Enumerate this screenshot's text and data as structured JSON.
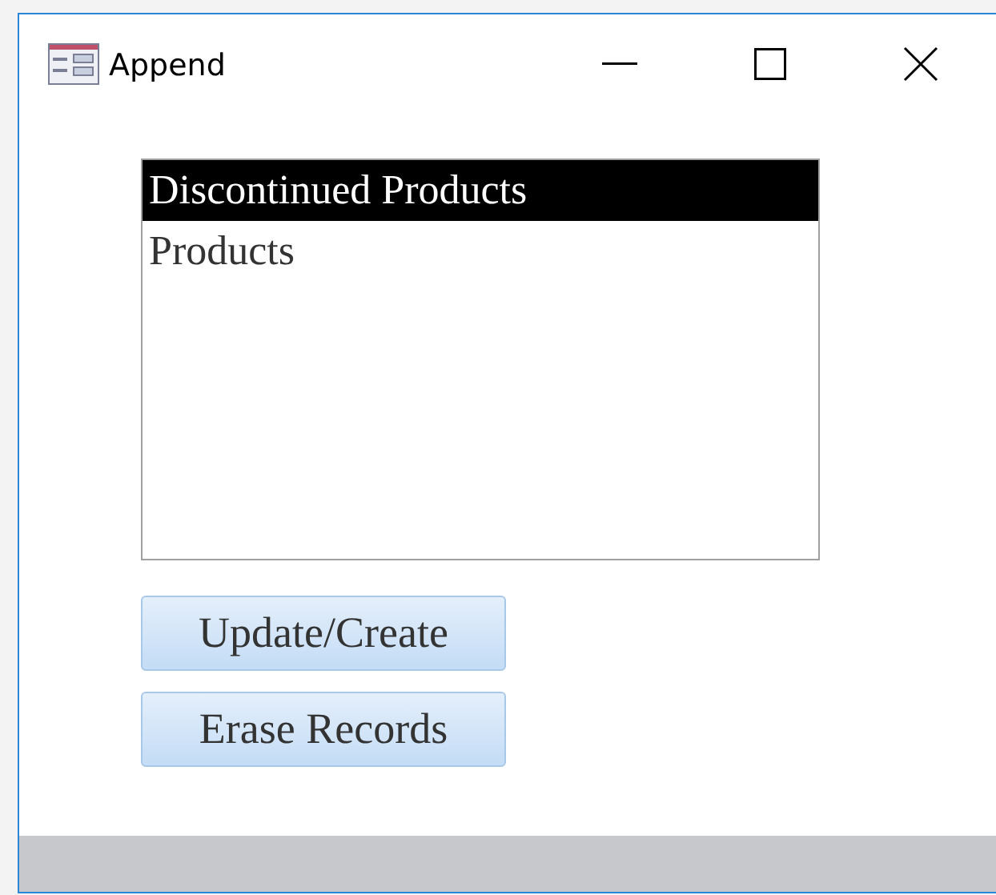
{
  "window": {
    "title": "Append",
    "controls": [
      {
        "kind": "minimize"
      },
      {
        "kind": "maximize"
      },
      {
        "kind": "close"
      }
    ]
  },
  "list": {
    "items": [
      {
        "label": "Discontinued Products",
        "selected": true
      },
      {
        "label": "Products",
        "selected": false
      }
    ]
  },
  "buttons": [
    "Update/Create",
    "Erase Records"
  ]
}
